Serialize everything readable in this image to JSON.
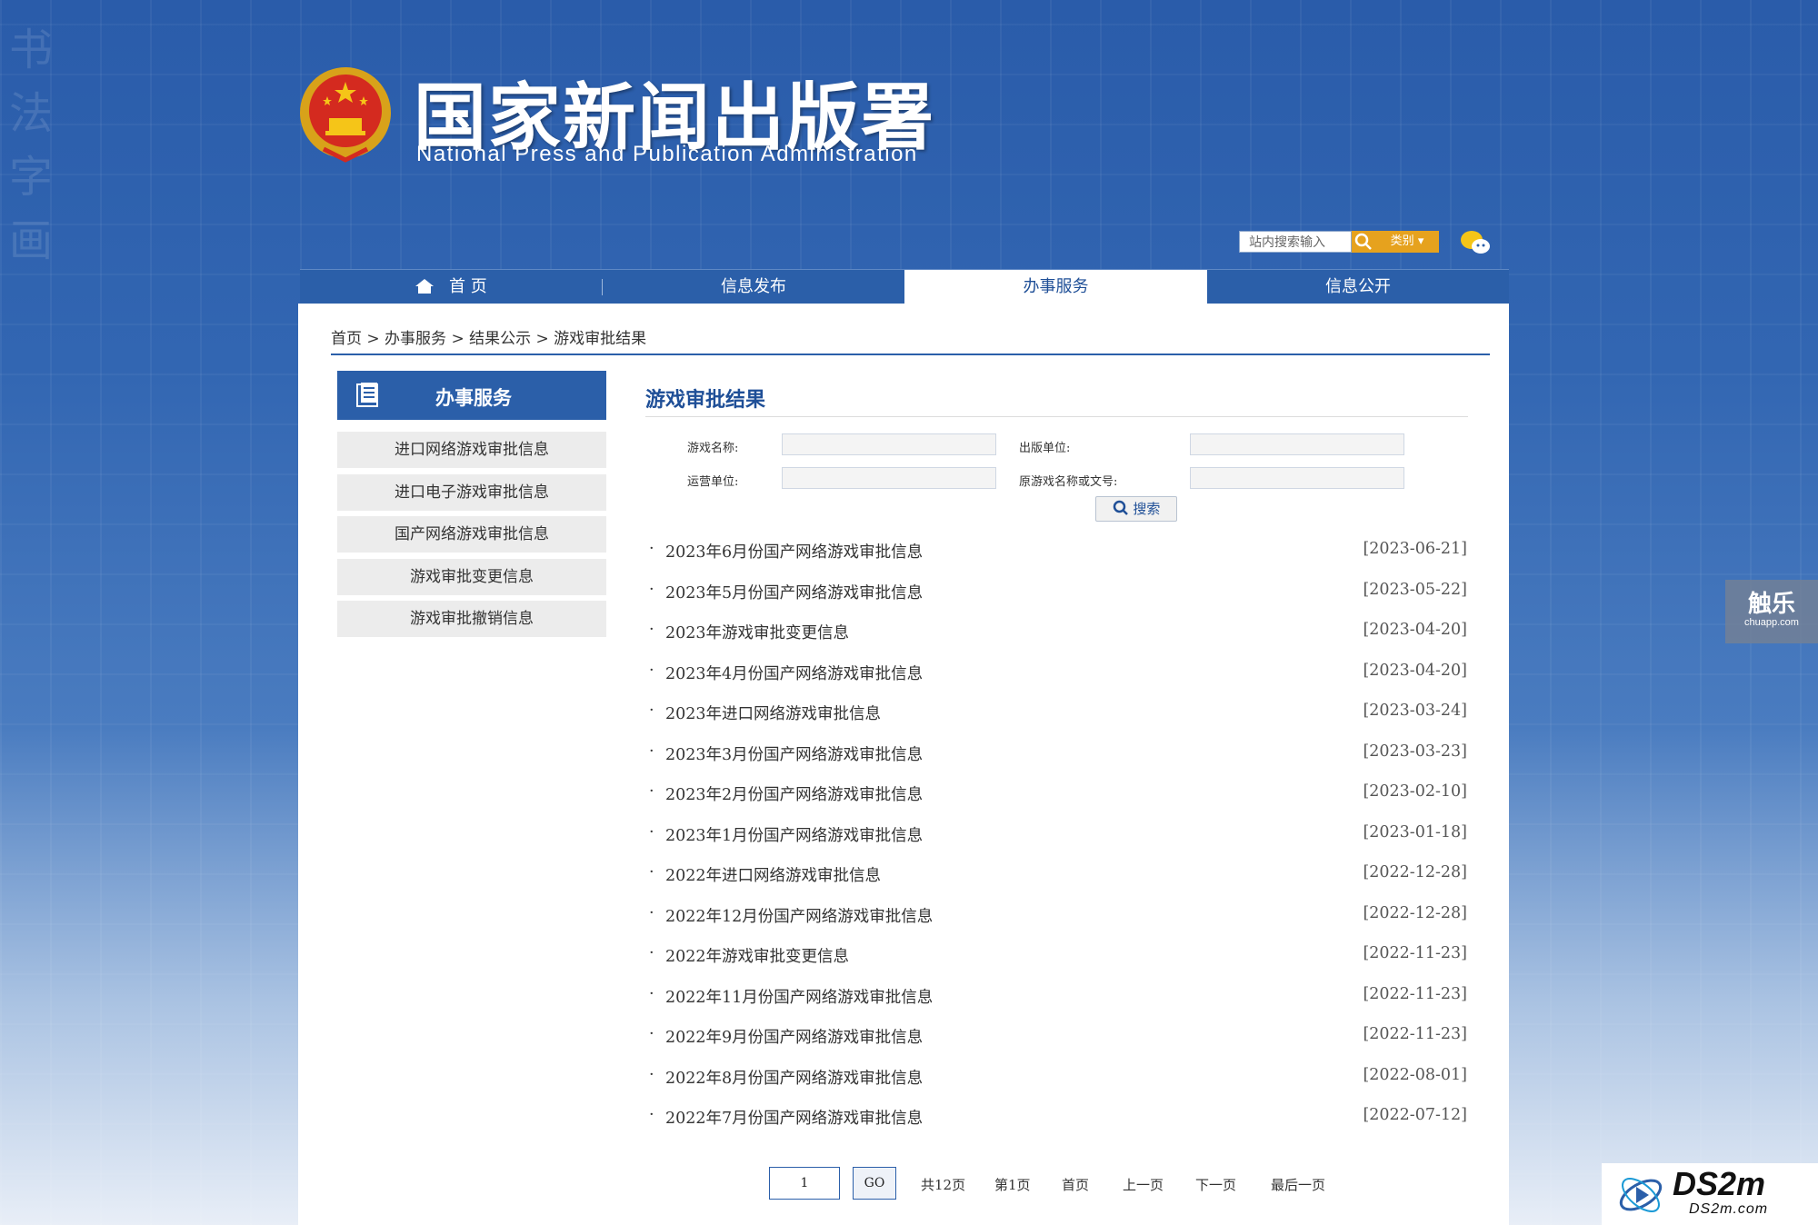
{
  "header": {
    "title_cn": "国家新闻出版署",
    "title_en": "National  Press and Publication Administration",
    "emblem_icon": "national-emblem-icon"
  },
  "search": {
    "placeholder": "站内搜索输入",
    "category_label": "类别",
    "wechat_icon": "wechat-icon"
  },
  "nav": {
    "items": [
      {
        "label": "首 页"
      },
      {
        "label": "信息发布"
      },
      {
        "label": "办事服务"
      },
      {
        "label": "信息公开"
      }
    ],
    "active_index": 2
  },
  "breadcrumb": "首页 > 办事服务 > 结果公示 > 游戏审批结果",
  "sidebar": {
    "title": "办事服务",
    "items": [
      {
        "label": "进口网络游戏审批信息"
      },
      {
        "label": "进口电子游戏审批信息"
      },
      {
        "label": "国产网络游戏审批信息"
      },
      {
        "label": "游戏审批变更信息"
      },
      {
        "label": "游戏审批撤销信息"
      }
    ]
  },
  "main": {
    "title": "游戏审批结果",
    "form": {
      "game_name_label": "游戏名称:",
      "publisher_label": "出版单位:",
      "operator_label": "运营单位:",
      "original_label": "原游戏名称或文号:",
      "search_button": "搜索"
    },
    "list": [
      {
        "title": "2023年6月份国产网络游戏审批信息",
        "date": "[2023-06-21]"
      },
      {
        "title": "2023年5月份国产网络游戏审批信息",
        "date": "[2023-05-22]"
      },
      {
        "title": "2023年游戏审批变更信息",
        "date": "[2023-04-20]"
      },
      {
        "title": "2023年4月份国产网络游戏审批信息",
        "date": "[2023-04-20]"
      },
      {
        "title": "2023年进口网络游戏审批信息",
        "date": "[2023-03-24]"
      },
      {
        "title": "2023年3月份国产网络游戏审批信息",
        "date": "[2023-03-23]"
      },
      {
        "title": "2023年2月份国产网络游戏审批信息",
        "date": "[2023-02-10]"
      },
      {
        "title": "2023年1月份国产网络游戏审批信息",
        "date": "[2023-01-18]"
      },
      {
        "title": "2022年进口网络游戏审批信息",
        "date": "[2022-12-28]"
      },
      {
        "title": "2022年12月份国产网络游戏审批信息",
        "date": "[2022-12-28]"
      },
      {
        "title": "2022年游戏审批变更信息",
        "date": "[2022-11-23]"
      },
      {
        "title": "2022年11月份国产网络游戏审批信息",
        "date": "[2022-11-23]"
      },
      {
        "title": "2022年9月份国产网络游戏审批信息",
        "date": "[2022-11-23]"
      },
      {
        "title": "2022年8月份国产网络游戏审批信息",
        "date": "[2022-08-01]"
      },
      {
        "title": "2022年7月份国产网络游戏审批信息",
        "date": "[2022-07-12]"
      }
    ]
  },
  "pager": {
    "page_input": "1",
    "go": "GO",
    "total": "共12页",
    "current": "第1页",
    "first": "首页",
    "prev": "上一页",
    "next": "下一页",
    "last": "最后一页"
  },
  "watermarks": {
    "chuapp_cn": "触乐",
    "chuapp_url": "chuapp.com",
    "ds2m_logo": "DS2m",
    "ds2m_url": "DS2m.com"
  },
  "colors": {
    "primary": "#2b5fa9",
    "accent": "#e6a21e",
    "title_blue": "#1f4f97"
  }
}
